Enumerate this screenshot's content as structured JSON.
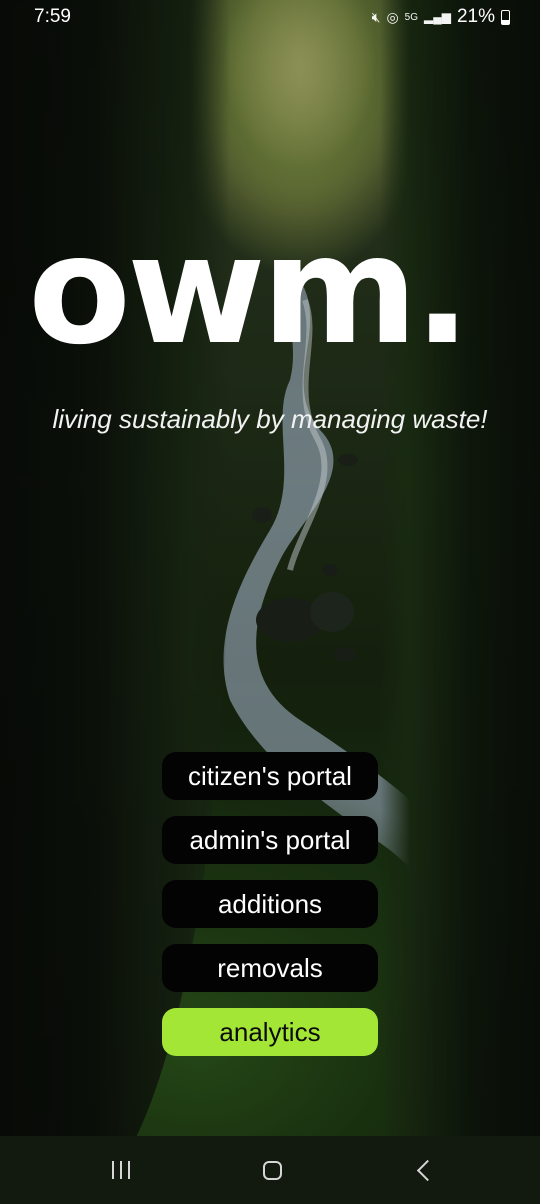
{
  "status_bar": {
    "time": "7:59",
    "network_label": "5G",
    "battery_percent": "21%"
  },
  "hero": {
    "logo": "owm.",
    "tagline": "living sustainably by managing waste!"
  },
  "menu": {
    "items": [
      {
        "label": "citizen's portal"
      },
      {
        "label": "admin's portal"
      },
      {
        "label": "additions"
      },
      {
        "label": "removals"
      },
      {
        "label": "analytics"
      }
    ],
    "accent_color": "#a3e635",
    "button_color": "#020302"
  },
  "nav_bar": {
    "icons": [
      "recent-apps-icon",
      "home-icon",
      "back-icon"
    ]
  }
}
